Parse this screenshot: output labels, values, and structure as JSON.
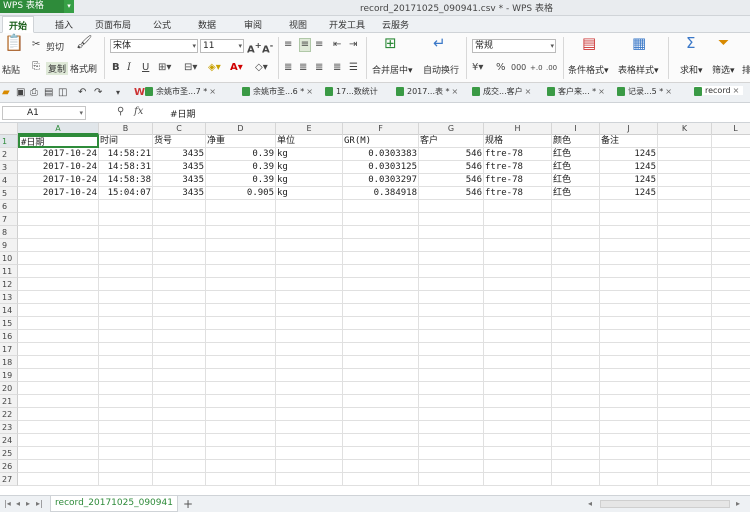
{
  "app": {
    "name": "WPS 表格",
    "doc_title": "record_20171025_090941.csv * - WPS 表格"
  },
  "menu": [
    "开始",
    "插入",
    "页面布局",
    "公式",
    "数据",
    "审阅",
    "视图",
    "开发工具",
    "云服务"
  ],
  "ribbon": {
    "paste": "粘贴",
    "cut": "剪切",
    "copy": "复制",
    "format_painter": "格式刷",
    "font_name": "宋体",
    "font_size": "11",
    "merge_center": "合并居中",
    "auto_wrap": "自动换行",
    "number_format": "常规",
    "cond_format": "条件格式",
    "table_style": "表格样式",
    "sum": "求和",
    "filter": "筛选",
    "sort": "排"
  },
  "doc_tabs": [
    "余姚市圣...7 *",
    "余姚市圣...6 *",
    "17...数统计",
    "2017...表 *",
    "成交...客户",
    "客户来... *",
    "记录...5 *",
    "record"
  ],
  "formula_bar": {
    "name_box": "A1",
    "fx": "fx",
    "content": "#日期"
  },
  "columns": [
    "A",
    "B",
    "C",
    "D",
    "E",
    "F",
    "G",
    "H",
    "I",
    "J",
    "K",
    "L"
  ],
  "row_numbers": [
    "1",
    "2",
    "3",
    "4",
    "5",
    "6",
    "7",
    "8",
    "9",
    "10",
    "11",
    "12",
    "13",
    "14",
    "15",
    "16",
    "17",
    "18",
    "19",
    "20",
    "21",
    "22",
    "23",
    "24",
    "25",
    "26",
    "27"
  ],
  "table": {
    "headers": [
      "#日期",
      "时间",
      "货号",
      "净重",
      "单位",
      "GR(M)",
      "客户",
      "规格",
      "颜色",
      "备注"
    ],
    "rows": [
      [
        "2017-10-24",
        "14:58:21",
        "3435",
        "0.39",
        "kg",
        "0.0303383",
        "546",
        "ftre-78",
        "红色",
        "1245"
      ],
      [
        "2017-10-24",
        "14:58:31",
        "3435",
        "0.39",
        "kg",
        "0.0303125",
        "546",
        "ftre-78",
        "红色",
        "1245"
      ],
      [
        "2017-10-24",
        "14:58:38",
        "3435",
        "0.39",
        "kg",
        "0.0303297",
        "546",
        "ftre-78",
        "红色",
        "1245"
      ],
      [
        "2017-10-24",
        "15:04:07",
        "3435",
        "0.905",
        "kg",
        "0.384918",
        "546",
        "ftre-78",
        "红色",
        "1245"
      ]
    ]
  },
  "sheet_tab": "record_20171025_090941",
  "colors": {
    "accent": "#2e8b3a",
    "grid_line": "#e0e0e0",
    "header_bg": "#f2f2f2"
  }
}
